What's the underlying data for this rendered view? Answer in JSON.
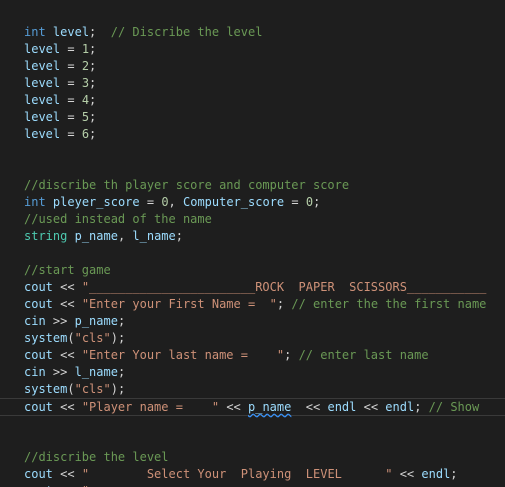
{
  "editor": {
    "lines": [
      {
        "tokens": [
          {
            "t": "int",
            "c": "kw"
          },
          {
            "t": " ",
            "c": "op"
          },
          {
            "t": "level",
            "c": "var"
          },
          {
            "t": ";  ",
            "c": "op"
          },
          {
            "t": "// Discribe the level",
            "c": "com"
          }
        ]
      },
      {
        "tokens": [
          {
            "t": "level",
            "c": "var"
          },
          {
            "t": " = ",
            "c": "op"
          },
          {
            "t": "1",
            "c": "num"
          },
          {
            "t": ";",
            "c": "op"
          }
        ]
      },
      {
        "tokens": [
          {
            "t": "level",
            "c": "var"
          },
          {
            "t": " = ",
            "c": "op"
          },
          {
            "t": "2",
            "c": "num"
          },
          {
            "t": ";",
            "c": "op"
          }
        ]
      },
      {
        "tokens": [
          {
            "t": "level",
            "c": "var"
          },
          {
            "t": " = ",
            "c": "op"
          },
          {
            "t": "3",
            "c": "num"
          },
          {
            "t": ";",
            "c": "op"
          }
        ]
      },
      {
        "tokens": [
          {
            "t": "level",
            "c": "var"
          },
          {
            "t": " = ",
            "c": "op"
          },
          {
            "t": "4",
            "c": "num"
          },
          {
            "t": ";",
            "c": "op"
          }
        ]
      },
      {
        "tokens": [
          {
            "t": "level",
            "c": "var"
          },
          {
            "t": " = ",
            "c": "op"
          },
          {
            "t": "5",
            "c": "num"
          },
          {
            "t": ";",
            "c": "op"
          }
        ]
      },
      {
        "tokens": [
          {
            "t": "level",
            "c": "var"
          },
          {
            "t": " = ",
            "c": "op"
          },
          {
            "t": "6",
            "c": "num"
          },
          {
            "t": ";",
            "c": "op"
          }
        ]
      },
      {
        "tokens": []
      },
      {
        "tokens": []
      },
      {
        "tokens": [
          {
            "t": "//discribe th player score and computer score",
            "c": "com"
          }
        ]
      },
      {
        "tokens": [
          {
            "t": "int",
            "c": "kw"
          },
          {
            "t": " ",
            "c": "op"
          },
          {
            "t": "pleyer_score",
            "c": "var"
          },
          {
            "t": " = ",
            "c": "op"
          },
          {
            "t": "0",
            "c": "num"
          },
          {
            "t": ", ",
            "c": "op"
          },
          {
            "t": "Computer_score",
            "c": "var"
          },
          {
            "t": " = ",
            "c": "op"
          },
          {
            "t": "0",
            "c": "num"
          },
          {
            "t": ";",
            "c": "op"
          }
        ]
      },
      {
        "tokens": [
          {
            "t": "//used instead of the name",
            "c": "com"
          }
        ]
      },
      {
        "tokens": [
          {
            "t": "string",
            "c": "type"
          },
          {
            "t": " ",
            "c": "op"
          },
          {
            "t": "p_name",
            "c": "var"
          },
          {
            "t": ", ",
            "c": "op"
          },
          {
            "t": "l_name",
            "c": "var"
          },
          {
            "t": ";",
            "c": "op"
          }
        ]
      },
      {
        "tokens": []
      },
      {
        "tokens": [
          {
            "t": "//start game",
            "c": "com"
          }
        ]
      },
      {
        "tokens": [
          {
            "t": "cout",
            "c": "var"
          },
          {
            "t": " << ",
            "c": "op"
          },
          {
            "t": "\"_______________________ROCK  PAPER  SCISSORS___________",
            "c": "str"
          }
        ]
      },
      {
        "tokens": [
          {
            "t": "cout",
            "c": "var"
          },
          {
            "t": " << ",
            "c": "op"
          },
          {
            "t": "\"Enter your First Name =  \"",
            "c": "str"
          },
          {
            "t": "; ",
            "c": "op"
          },
          {
            "t": "// enter the the first name",
            "c": "com"
          }
        ]
      },
      {
        "tokens": [
          {
            "t": "cin",
            "c": "var"
          },
          {
            "t": " >> ",
            "c": "op"
          },
          {
            "t": "p_name",
            "c": "var"
          },
          {
            "t": ";",
            "c": "op"
          }
        ]
      },
      {
        "tokens": [
          {
            "t": "system",
            "c": "var"
          },
          {
            "t": "(",
            "c": "op"
          },
          {
            "t": "\"cls\"",
            "c": "str"
          },
          {
            "t": ");",
            "c": "op"
          }
        ]
      },
      {
        "tokens": [
          {
            "t": "cout",
            "c": "var"
          },
          {
            "t": " << ",
            "c": "op"
          },
          {
            "t": "\"Enter Your last name =    \"",
            "c": "str"
          },
          {
            "t": "; ",
            "c": "op"
          },
          {
            "t": "// enter last name",
            "c": "com"
          }
        ]
      },
      {
        "tokens": [
          {
            "t": "cin",
            "c": "var"
          },
          {
            "t": " >> ",
            "c": "op"
          },
          {
            "t": "l_name",
            "c": "var"
          },
          {
            "t": ";",
            "c": "op"
          }
        ]
      },
      {
        "tokens": [
          {
            "t": "system",
            "c": "var"
          },
          {
            "t": "(",
            "c": "op"
          },
          {
            "t": "\"cls\"",
            "c": "str"
          },
          {
            "t": ");",
            "c": "op"
          }
        ]
      },
      {
        "tokens": [
          {
            "t": "cout",
            "c": "var"
          },
          {
            "t": " << ",
            "c": "op"
          },
          {
            "t": "\"Player name =    \"",
            "c": "str"
          },
          {
            "t": " << ",
            "c": "op"
          },
          {
            "t": "p_name",
            "c": "var",
            "sq": true
          },
          {
            "t": "  << ",
            "c": "op"
          },
          {
            "t": "endl",
            "c": "var"
          },
          {
            "t": " << ",
            "c": "op"
          },
          {
            "t": "endl",
            "c": "var"
          },
          {
            "t": "; ",
            "c": "op"
          },
          {
            "t": "// Show",
            "c": "com"
          }
        ],
        "current": true
      },
      {
        "tokens": []
      },
      {
        "tokens": []
      },
      {
        "tokens": [
          {
            "t": "//discribe the level",
            "c": "com"
          }
        ]
      },
      {
        "tokens": [
          {
            "t": "cout",
            "c": "var"
          },
          {
            "t": " << ",
            "c": "op"
          },
          {
            "t": "\"        Select Your  Playing  LEVEL      \"",
            "c": "str"
          },
          {
            "t": " << ",
            "c": "op"
          },
          {
            "t": "endl",
            "c": "var"
          },
          {
            "t": ";",
            "c": "op"
          }
        ]
      },
      {
        "tokens": [
          {
            "t": "cout",
            "c": "var"
          },
          {
            "t": " << ",
            "c": "op"
          },
          {
            "t": "\"",
            "c": "str"
          }
        ]
      }
    ]
  }
}
